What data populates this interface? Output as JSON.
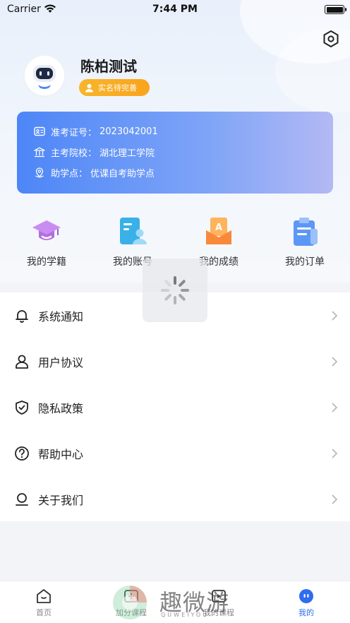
{
  "status_bar": {
    "carrier": "Carrier",
    "time": "7:44 PM"
  },
  "profile": {
    "name": "陈柏测试",
    "verify_badge": "实名待完善"
  },
  "info_card": {
    "exam_id_label": "准考证号：",
    "exam_id_value": "2023042001",
    "school_label": "主考院校：",
    "school_value": "湖北理工学院",
    "center_label": "助学点：",
    "center_value": "优课自考助学点"
  },
  "quick_actions": [
    {
      "label": "我的学籍",
      "icon": "graduation-cap-icon"
    },
    {
      "label": "我的账号",
      "icon": "account-card-icon"
    },
    {
      "label": "我的成绩",
      "icon": "grade-envelope-icon"
    },
    {
      "label": "我的订单",
      "icon": "order-clipboard-icon"
    }
  ],
  "menu": [
    {
      "label": "系统通知",
      "icon": "bell-icon"
    },
    {
      "label": "用户协议",
      "icon": "user-icon"
    },
    {
      "label": "隐私政策",
      "icon": "shield-check-icon"
    },
    {
      "label": "帮助中心",
      "icon": "question-circle-icon"
    },
    {
      "label": "关于我们",
      "icon": "about-icon"
    }
  ],
  "tabbar": [
    {
      "label": "首页",
      "icon": "home-icon"
    },
    {
      "label": "加分课程",
      "icon": "plus-course-icon"
    },
    {
      "label": "我的课程",
      "icon": "my-course-icon"
    },
    {
      "label": "我的",
      "icon": "robot-face-icon",
      "active": true
    }
  ],
  "watermark": {
    "big": "趣微游",
    "small": "QUWEIYOU"
  },
  "colors": {
    "accent": "#2e6cf0",
    "badge": "#f9a41d",
    "card_start": "#4d86f7",
    "card_end": "#b3b9f4"
  }
}
